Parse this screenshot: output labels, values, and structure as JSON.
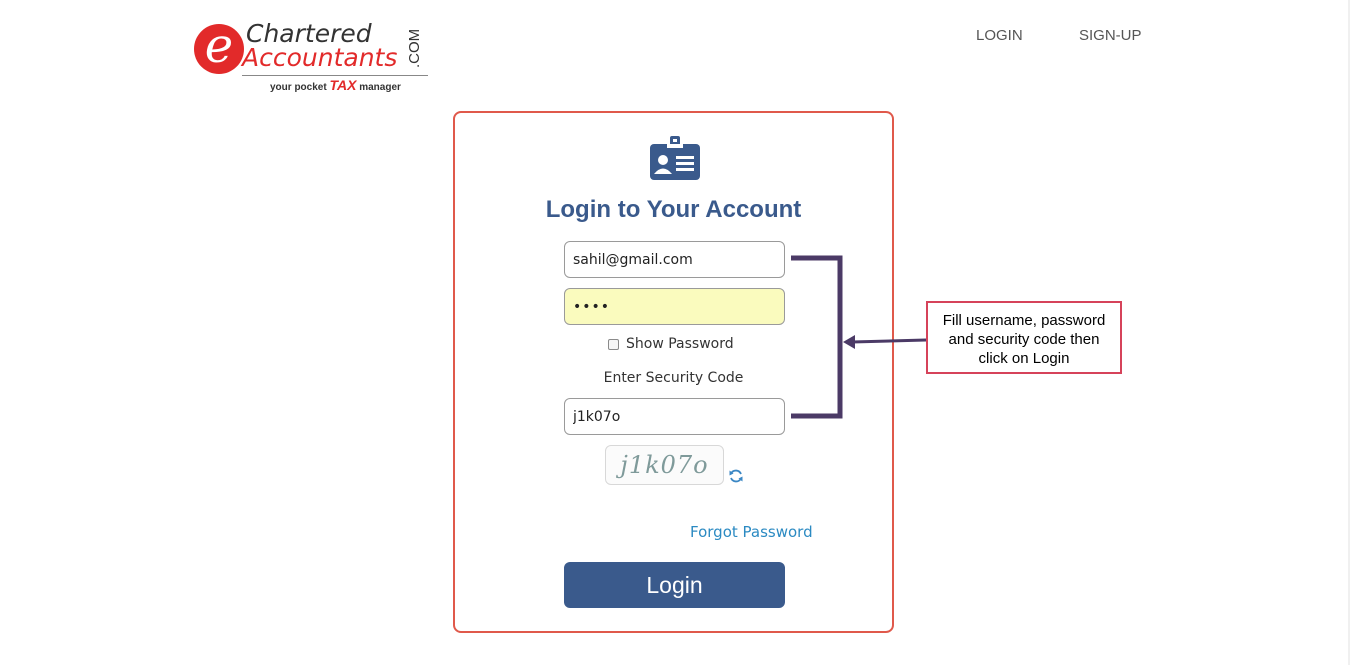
{
  "logo": {
    "brand_line1": "Chartered",
    "brand_line2": "Accountants",
    "brand_suffix": ".COM",
    "brand_letter": "e",
    "tagline_pre": "your pocket",
    "tagline_tax": "TAX",
    "tagline_post": "manager"
  },
  "nav": {
    "login": "LOGIN",
    "signup": "SIGN-UP"
  },
  "login_form": {
    "title": "Login to Your Account",
    "username_value": "sahil@gmail.com",
    "password_value": "••••",
    "show_password_label": "Show Password",
    "show_password_checked": false,
    "security_code_label": "Enter Security Code",
    "security_code_value": "j1k07o",
    "captcha_text": "j1k07o",
    "forgot_password": "Forgot Password",
    "login_button": "Login"
  },
  "annotation": {
    "text": "Fill username, password\nand  security code then\nclick on Login"
  },
  "colors": {
    "card_border": "#e0594b",
    "primary": "#3a5a8c",
    "link": "#2b8ac2",
    "password_bg": "#fafbbe",
    "callout_border": "#d6435a",
    "annotation_line": "#4b3a66",
    "brand_red": "#e22a2a"
  },
  "icons": {
    "badge": "id-badge-icon",
    "refresh": "refresh-icon"
  }
}
